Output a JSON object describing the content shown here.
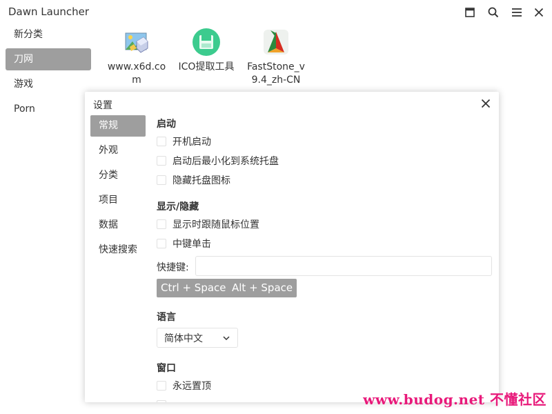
{
  "app": {
    "title": "Dawn Launcher"
  },
  "window_controls": [
    "maximize-icon",
    "search-icon",
    "menu-icon",
    "close-icon"
  ],
  "sidebar": {
    "items": [
      {
        "label": "新分类",
        "active": false
      },
      {
        "label": "刀网",
        "active": true
      },
      {
        "label": "游戏",
        "active": false
      },
      {
        "label": "Porn",
        "active": false
      }
    ]
  },
  "items": [
    {
      "label": "www.x6d.com",
      "icon": "landscape-image-icon"
    },
    {
      "label": "ICO提取工具",
      "icon": "green-save-icon"
    },
    {
      "label": "FastStone_v9.4_zh-CN",
      "icon": "faststone-icon"
    }
  ],
  "settings": {
    "title": "设置",
    "nav": [
      {
        "label": "常规",
        "active": true
      },
      {
        "label": "外观",
        "active": false
      },
      {
        "label": "分类",
        "active": false
      },
      {
        "label": "项目",
        "active": false
      },
      {
        "label": "数据",
        "active": false
      },
      {
        "label": "快速搜索",
        "active": false
      }
    ],
    "startup": {
      "title": "启动",
      "options": [
        {
          "label": "开机启动",
          "checked": false
        },
        {
          "label": "启动后最小化到系统托盘",
          "checked": false
        },
        {
          "label": "隐藏托盘图标",
          "checked": false
        }
      ]
    },
    "show_hide": {
      "title": "显示/隐藏",
      "options": [
        {
          "label": "显示时跟随鼠标位置",
          "checked": false
        },
        {
          "label": "中键单击",
          "checked": false
        }
      ],
      "hotkey_label": "快捷键:",
      "hotkey_value": "",
      "presets": [
        "Ctrl + Space",
        "Alt + Space"
      ]
    },
    "language": {
      "title": "语言",
      "selected": "简体中文"
    },
    "window": {
      "title": "窗口",
      "options": [
        {
          "label": "永远置顶",
          "checked": false
        }
      ]
    }
  },
  "watermark": "www.budog.net 不懂社区",
  "colors": {
    "active_bg": "#9e9e9e",
    "active_text": "#ffffff",
    "watermark": "#e8197a"
  }
}
